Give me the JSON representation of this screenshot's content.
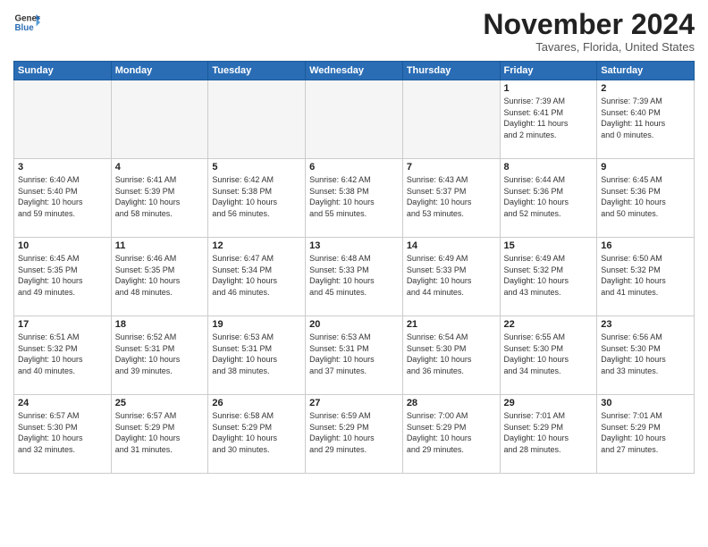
{
  "header": {
    "logo_general": "General",
    "logo_blue": "Blue",
    "title": "November 2024",
    "location": "Tavares, Florida, United States"
  },
  "weekdays": [
    "Sunday",
    "Monday",
    "Tuesday",
    "Wednesday",
    "Thursday",
    "Friday",
    "Saturday"
  ],
  "weeks": [
    [
      {
        "day": "",
        "info": ""
      },
      {
        "day": "",
        "info": ""
      },
      {
        "day": "",
        "info": ""
      },
      {
        "day": "",
        "info": ""
      },
      {
        "day": "",
        "info": ""
      },
      {
        "day": "1",
        "info": "Sunrise: 7:39 AM\nSunset: 6:41 PM\nDaylight: 11 hours\nand 2 minutes."
      },
      {
        "day": "2",
        "info": "Sunrise: 7:39 AM\nSunset: 6:40 PM\nDaylight: 11 hours\nand 0 minutes."
      }
    ],
    [
      {
        "day": "3",
        "info": "Sunrise: 6:40 AM\nSunset: 5:40 PM\nDaylight: 10 hours\nand 59 minutes."
      },
      {
        "day": "4",
        "info": "Sunrise: 6:41 AM\nSunset: 5:39 PM\nDaylight: 10 hours\nand 58 minutes."
      },
      {
        "day": "5",
        "info": "Sunrise: 6:42 AM\nSunset: 5:38 PM\nDaylight: 10 hours\nand 56 minutes."
      },
      {
        "day": "6",
        "info": "Sunrise: 6:42 AM\nSunset: 5:38 PM\nDaylight: 10 hours\nand 55 minutes."
      },
      {
        "day": "7",
        "info": "Sunrise: 6:43 AM\nSunset: 5:37 PM\nDaylight: 10 hours\nand 53 minutes."
      },
      {
        "day": "8",
        "info": "Sunrise: 6:44 AM\nSunset: 5:36 PM\nDaylight: 10 hours\nand 52 minutes."
      },
      {
        "day": "9",
        "info": "Sunrise: 6:45 AM\nSunset: 5:36 PM\nDaylight: 10 hours\nand 50 minutes."
      }
    ],
    [
      {
        "day": "10",
        "info": "Sunrise: 6:45 AM\nSunset: 5:35 PM\nDaylight: 10 hours\nand 49 minutes."
      },
      {
        "day": "11",
        "info": "Sunrise: 6:46 AM\nSunset: 5:35 PM\nDaylight: 10 hours\nand 48 minutes."
      },
      {
        "day": "12",
        "info": "Sunrise: 6:47 AM\nSunset: 5:34 PM\nDaylight: 10 hours\nand 46 minutes."
      },
      {
        "day": "13",
        "info": "Sunrise: 6:48 AM\nSunset: 5:33 PM\nDaylight: 10 hours\nand 45 minutes."
      },
      {
        "day": "14",
        "info": "Sunrise: 6:49 AM\nSunset: 5:33 PM\nDaylight: 10 hours\nand 44 minutes."
      },
      {
        "day": "15",
        "info": "Sunrise: 6:49 AM\nSunset: 5:32 PM\nDaylight: 10 hours\nand 43 minutes."
      },
      {
        "day": "16",
        "info": "Sunrise: 6:50 AM\nSunset: 5:32 PM\nDaylight: 10 hours\nand 41 minutes."
      }
    ],
    [
      {
        "day": "17",
        "info": "Sunrise: 6:51 AM\nSunset: 5:32 PM\nDaylight: 10 hours\nand 40 minutes."
      },
      {
        "day": "18",
        "info": "Sunrise: 6:52 AM\nSunset: 5:31 PM\nDaylight: 10 hours\nand 39 minutes."
      },
      {
        "day": "19",
        "info": "Sunrise: 6:53 AM\nSunset: 5:31 PM\nDaylight: 10 hours\nand 38 minutes."
      },
      {
        "day": "20",
        "info": "Sunrise: 6:53 AM\nSunset: 5:31 PM\nDaylight: 10 hours\nand 37 minutes."
      },
      {
        "day": "21",
        "info": "Sunrise: 6:54 AM\nSunset: 5:30 PM\nDaylight: 10 hours\nand 36 minutes."
      },
      {
        "day": "22",
        "info": "Sunrise: 6:55 AM\nSunset: 5:30 PM\nDaylight: 10 hours\nand 34 minutes."
      },
      {
        "day": "23",
        "info": "Sunrise: 6:56 AM\nSunset: 5:30 PM\nDaylight: 10 hours\nand 33 minutes."
      }
    ],
    [
      {
        "day": "24",
        "info": "Sunrise: 6:57 AM\nSunset: 5:30 PM\nDaylight: 10 hours\nand 32 minutes."
      },
      {
        "day": "25",
        "info": "Sunrise: 6:57 AM\nSunset: 5:29 PM\nDaylight: 10 hours\nand 31 minutes."
      },
      {
        "day": "26",
        "info": "Sunrise: 6:58 AM\nSunset: 5:29 PM\nDaylight: 10 hours\nand 30 minutes."
      },
      {
        "day": "27",
        "info": "Sunrise: 6:59 AM\nSunset: 5:29 PM\nDaylight: 10 hours\nand 29 minutes."
      },
      {
        "day": "28",
        "info": "Sunrise: 7:00 AM\nSunset: 5:29 PM\nDaylight: 10 hours\nand 29 minutes."
      },
      {
        "day": "29",
        "info": "Sunrise: 7:01 AM\nSunset: 5:29 PM\nDaylight: 10 hours\nand 28 minutes."
      },
      {
        "day": "30",
        "info": "Sunrise: 7:01 AM\nSunset: 5:29 PM\nDaylight: 10 hours\nand 27 minutes."
      }
    ]
  ]
}
